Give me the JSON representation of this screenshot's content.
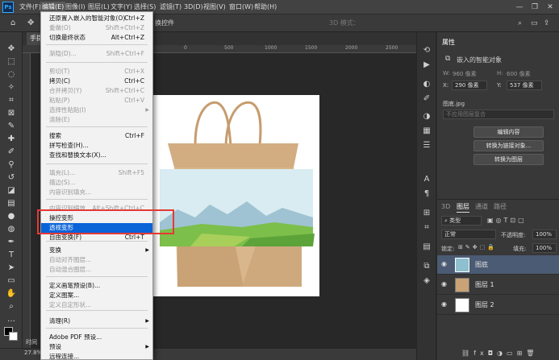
{
  "menubar": {
    "logo": "Ps",
    "items": [
      "文件(F)",
      "编辑(E)",
      "图像(I)",
      "图层(L)",
      "文字(Y)",
      "选择(S)",
      "滤镜(T)",
      "3D(D)",
      "视图(V)",
      "窗口(W)",
      "帮助(H)"
    ],
    "active_index": 1,
    "window_controls": [
      "—",
      "❐",
      "✕"
    ]
  },
  "options_bar": {
    "home_icon": "home-icon",
    "transform_controls_text": "换控件",
    "mode_3d_text": "3D 模式："
  },
  "doc_tab": {
    "label": "手提"
  },
  "status": {
    "zoom": "27.8%",
    "label": "时间"
  },
  "edit_menu": {
    "items": [
      {
        "label": "还原置入嵌入的智能对象(O)",
        "shortcut": "Ctrl+Z",
        "disabled": false
      },
      {
        "label": "重做(O)",
        "shortcut": "Shift+Ctrl+Z",
        "disabled": true
      },
      {
        "label": "切换最终状态",
        "shortcut": "Alt+Ctrl+Z",
        "disabled": false
      },
      {
        "label": "渐隐(D)...",
        "shortcut": "Shift+Ctrl+F",
        "disabled": true
      },
      {
        "label": "剪切(T)",
        "shortcut": "Ctrl+X",
        "disabled": true
      },
      {
        "label": "拷贝(C)",
        "shortcut": "Ctrl+C",
        "disabled": false
      },
      {
        "label": "合并拷贝(Y)",
        "shortcut": "Shift+Ctrl+C",
        "disabled": true
      },
      {
        "label": "粘贴(P)",
        "shortcut": "Ctrl+V",
        "disabled": true
      },
      {
        "label": "选择性粘贴(I)",
        "shortcut": "",
        "submenu": true,
        "disabled": true
      },
      {
        "label": "清除(E)",
        "shortcut": "",
        "disabled": true
      },
      {
        "label": "搜索",
        "shortcut": "Ctrl+F",
        "disabled": false
      },
      {
        "label": "拼写检查(H)...",
        "shortcut": "",
        "disabled": false
      },
      {
        "label": "查找和替换文本(X)...",
        "shortcut": "",
        "disabled": false
      },
      {
        "label": "填充(L)...",
        "shortcut": "Shift+F5",
        "disabled": true
      },
      {
        "label": "描边(S)...",
        "shortcut": "",
        "disabled": true
      },
      {
        "label": "内容识别填充...",
        "shortcut": "",
        "disabled": true
      },
      {
        "label": "内容识别缩放",
        "shortcut": "Alt+Shift+Ctrl+C",
        "disabled": true
      },
      {
        "label": "操控变形",
        "shortcut": "",
        "disabled": false
      },
      {
        "label": "透视变形",
        "shortcut": "",
        "disabled": false,
        "highlighted": true
      },
      {
        "label": "自由变换(F)",
        "shortcut": "Ctrl+T",
        "disabled": false
      },
      {
        "label": "变换",
        "shortcut": "",
        "submenu": true,
        "disabled": false
      },
      {
        "label": "自动对齐图层...",
        "shortcut": "",
        "disabled": true
      },
      {
        "label": "自动混合图层...",
        "shortcut": "",
        "disabled": true
      },
      {
        "label": "定义画笔预设(B)...",
        "shortcut": "",
        "disabled": false
      },
      {
        "label": "定义图案...",
        "shortcut": "",
        "disabled": false
      },
      {
        "label": "定义自定形状...",
        "shortcut": "",
        "disabled": true
      },
      {
        "label": "清理(R)",
        "shortcut": "",
        "submenu": true,
        "disabled": false
      },
      {
        "label": "Adobe PDF 预设...",
        "shortcut": "",
        "disabled": false
      },
      {
        "label": "预设",
        "shortcut": "",
        "submenu": true,
        "disabled": false
      },
      {
        "label": "远程连接...",
        "shortcut": "",
        "disabled": false
      }
    ]
  },
  "properties": {
    "title": "属性",
    "object_type": "嵌入的智能对象",
    "w_label": "W:",
    "w_value": "960 像素",
    "h_label": "H:",
    "h_value": "600 像素",
    "x_label": "X:",
    "x_value": "290 像素",
    "y_label": "Y:",
    "y_value": "537 像素",
    "file": "图底.jpg",
    "comp_placeholder": "不应用图层复合",
    "buttons": [
      "编辑内容",
      "转换为链接对象...",
      "转换为图层"
    ]
  },
  "layers_panel": {
    "tabs": [
      "3D",
      "图层",
      "通道",
      "路径"
    ],
    "active_tab": 1,
    "filter_label": "类型",
    "blend_mode": "正常",
    "opacity_label": "不透明度:",
    "opacity_value": "100%",
    "lock_label": "锁定:",
    "fill_label": "填充:",
    "fill_value": "100%",
    "layers": [
      {
        "name": "图底",
        "selected": true
      },
      {
        "name": "图层 1",
        "selected": false
      },
      {
        "name": "图层 2",
        "selected": false
      }
    ]
  },
  "colors": {
    "menu_highlight": "#0a64d8",
    "annotation_box": "#e53935",
    "layer_selected": "#4a5b73"
  }
}
